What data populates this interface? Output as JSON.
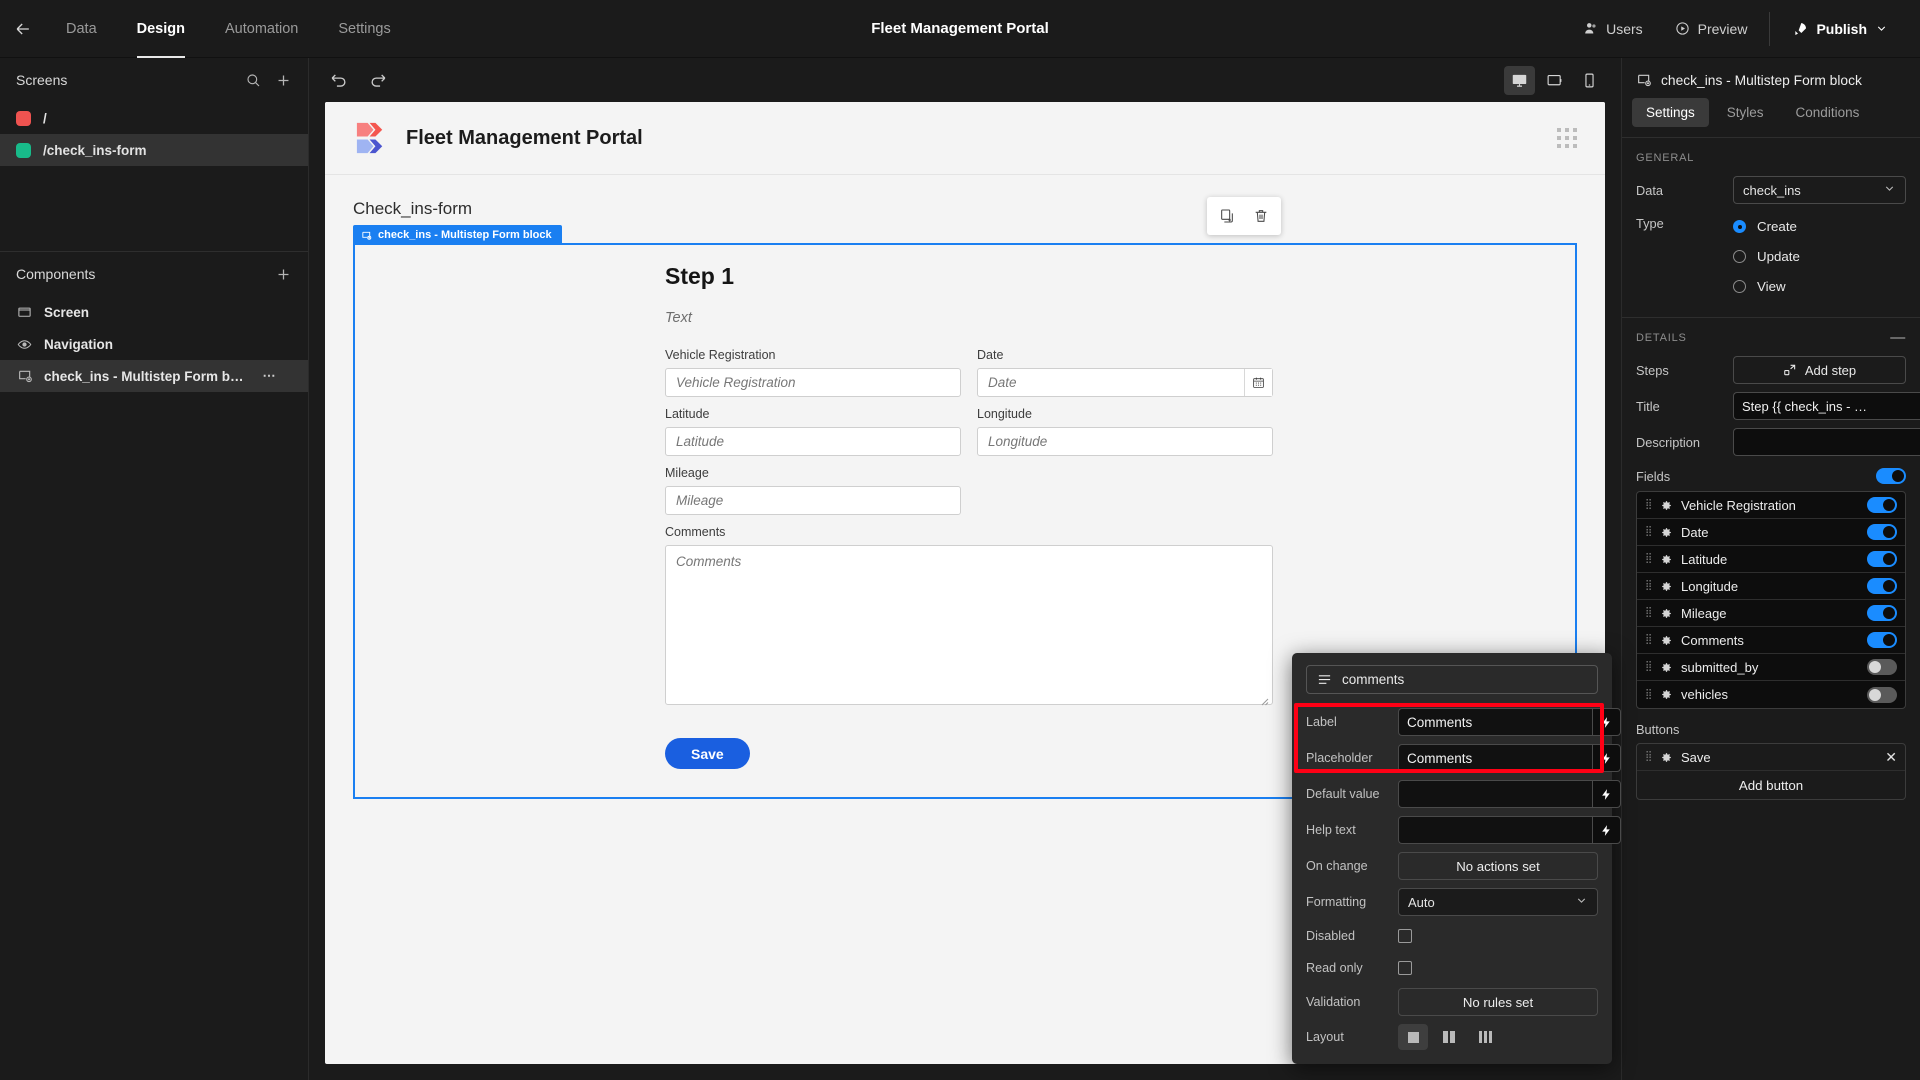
{
  "topbar": {
    "back_icon": "arrow-left-icon",
    "nav": [
      {
        "label": "Data",
        "active": false
      },
      {
        "label": "Design",
        "active": true
      },
      {
        "label": "Automation",
        "active": false
      },
      {
        "label": "Settings",
        "active": false
      }
    ],
    "title": "Fleet Management Portal",
    "users_label": "Users",
    "preview_label": "Preview",
    "publish_label": "Publish"
  },
  "left": {
    "screens_header": "Screens",
    "screens": [
      {
        "label": "/",
        "color": "#ef5350",
        "selected": false
      },
      {
        "label": "/check_ins-form",
        "color": "#18bb8a",
        "selected": true
      }
    ],
    "components_header": "Components",
    "components": [
      {
        "label": "Screen",
        "icon": "screen-icon",
        "selected": false
      },
      {
        "label": "Navigation",
        "icon": "eye-icon",
        "selected": false
      },
      {
        "label": "check_ins - Multistep Form b…",
        "icon": "form-block-icon",
        "selected": true,
        "more": "⋯"
      }
    ]
  },
  "canvas": {
    "app_name": "Fleet Management Portal",
    "screen_title": "Check_ins-form",
    "block_tag": "check_ins - Multistep Form block",
    "step_title": "Step 1",
    "step_description": "Text",
    "fields": [
      {
        "label": "Vehicle Registration",
        "placeholder": "Vehicle Registration",
        "type": "text",
        "width": "half"
      },
      {
        "label": "Date",
        "placeholder": "Date",
        "type": "date",
        "width": "half"
      },
      {
        "label": "Latitude",
        "placeholder": "Latitude",
        "type": "text",
        "width": "half"
      },
      {
        "label": "Longitude",
        "placeholder": "Longitude",
        "type": "text",
        "width": "half"
      },
      {
        "label": "Mileage",
        "placeholder": "Mileage",
        "type": "text",
        "width": "half"
      },
      {
        "label": "Comments",
        "placeholder": "Comments",
        "type": "textarea",
        "width": "full"
      }
    ],
    "save_label": "Save"
  },
  "devices": [
    {
      "name": "desktop-icon",
      "active": true
    },
    {
      "name": "tablet-icon",
      "active": false
    },
    {
      "name": "mobile-icon",
      "active": false
    }
  ],
  "right": {
    "title": "check_ins - Multistep Form block",
    "tabs": [
      {
        "label": "Settings",
        "active": true
      },
      {
        "label": "Styles",
        "active": false
      },
      {
        "label": "Conditions",
        "active": false
      }
    ],
    "general_header": "GENERAL",
    "data_label": "Data",
    "data_value": "check_ins",
    "type_label": "Type",
    "type_options": [
      {
        "label": "Create",
        "selected": true
      },
      {
        "label": "Update",
        "selected": false
      },
      {
        "label": "View",
        "selected": false
      }
    ],
    "details_header": "DETAILS",
    "steps_label": "Steps",
    "add_step_label": "Add step",
    "title_label": "Title",
    "title_value": "Step {{ check_ins - …",
    "description_label": "Description",
    "description_value": "",
    "fields_label": "Fields",
    "fields_enabled": true,
    "fields": [
      {
        "label": "Vehicle Registration",
        "enabled": true
      },
      {
        "label": "Date",
        "enabled": true
      },
      {
        "label": "Latitude",
        "enabled": true
      },
      {
        "label": "Longitude",
        "enabled": true
      },
      {
        "label": "Mileage",
        "enabled": true
      },
      {
        "label": "Comments",
        "enabled": true
      },
      {
        "label": "submitted_by",
        "enabled": false
      },
      {
        "label": "vehicles",
        "enabled": false
      }
    ],
    "buttons_label": "Buttons",
    "buttons": [
      {
        "label": "Save"
      }
    ],
    "add_button_label": "Add button"
  },
  "popover": {
    "field_name": "comments",
    "rows": [
      {
        "key": "Label",
        "type": "input",
        "value": "Comments",
        "highlight": true
      },
      {
        "key": "Placeholder",
        "type": "input",
        "value": "Comments",
        "highlight": true
      },
      {
        "key": "Default value",
        "type": "input",
        "value": ""
      },
      {
        "key": "Help text",
        "type": "input",
        "value": ""
      },
      {
        "key": "On change",
        "type": "button",
        "value": "No actions set"
      },
      {
        "key": "Formatting",
        "type": "select",
        "value": "Auto"
      },
      {
        "key": "Disabled",
        "type": "checkbox",
        "value": false
      },
      {
        "key": "Read only",
        "type": "checkbox",
        "value": false
      },
      {
        "key": "Validation",
        "type": "button",
        "value": "No rules set"
      },
      {
        "key": "Layout",
        "type": "layout",
        "value": 1
      }
    ]
  },
  "colors": {
    "accent_blue": "#1a8cff",
    "selection_blue": "#1a7ff1",
    "highlight_red": "#ff0015",
    "save_blue": "#1a5fe0"
  }
}
